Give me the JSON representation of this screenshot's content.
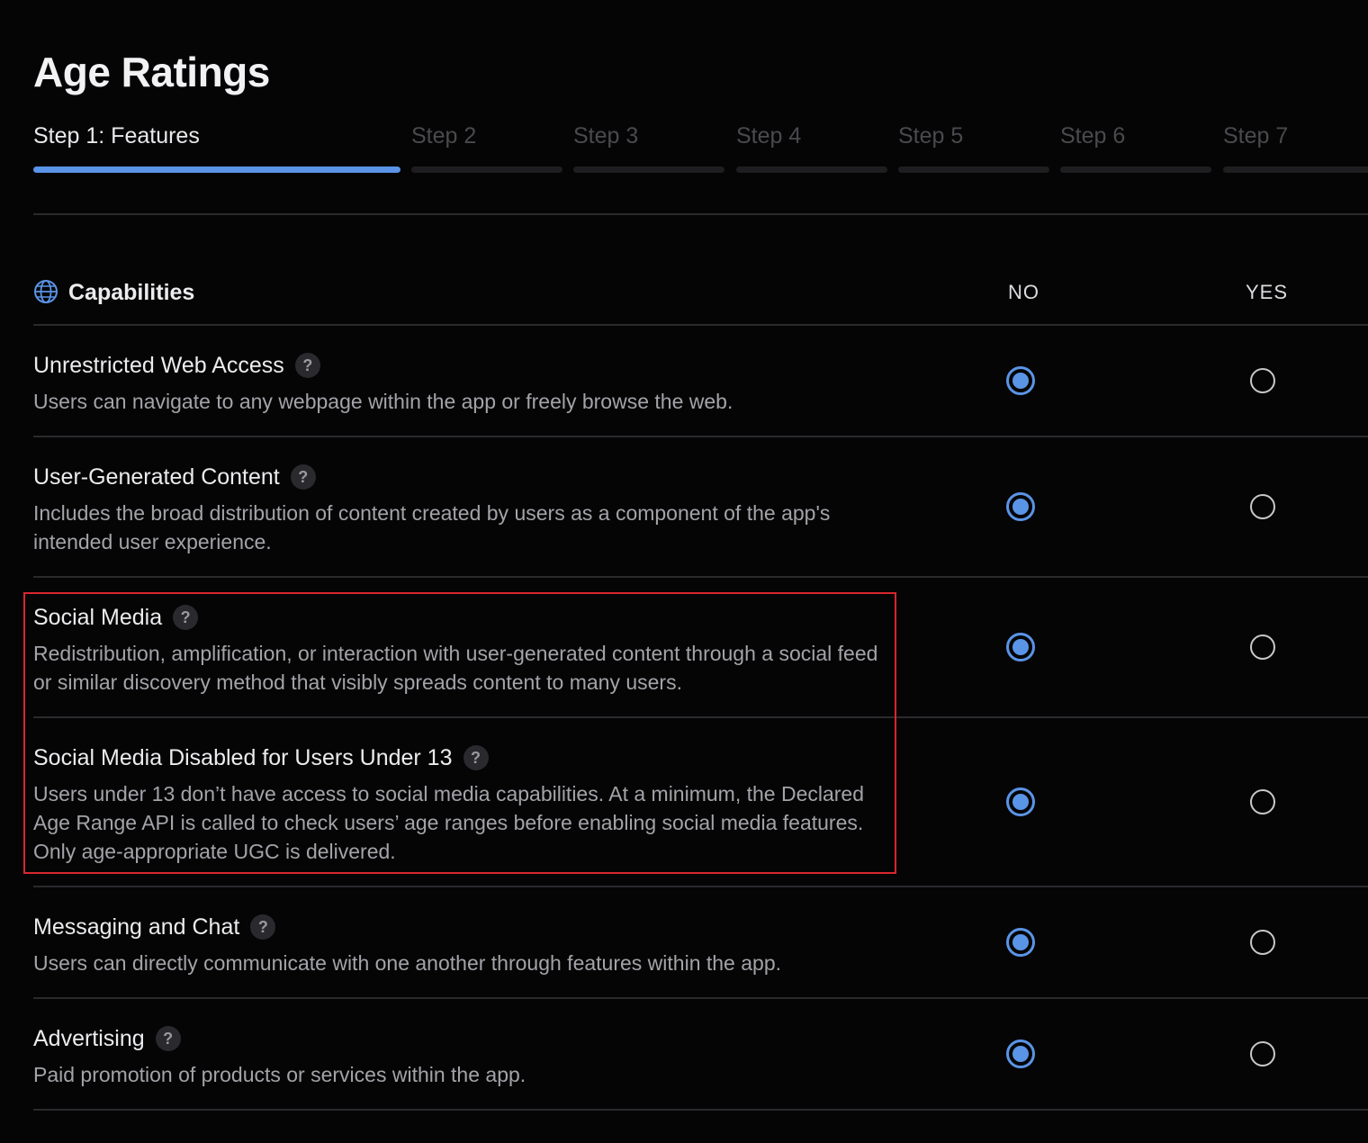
{
  "page": {
    "title": "Age Ratings"
  },
  "steps": [
    {
      "label": "Step 1: Features",
      "active": true
    },
    {
      "label": "Step 2",
      "active": false
    },
    {
      "label": "Step 3",
      "active": false
    },
    {
      "label": "Step 4",
      "active": false
    },
    {
      "label": "Step 5",
      "active": false
    },
    {
      "label": "Step 6",
      "active": false
    },
    {
      "label": "Step 7",
      "active": false
    }
  ],
  "section": {
    "title": "Capabilities",
    "icon": "globe-icon",
    "col_no": "NO",
    "col_yes": "YES"
  },
  "rows": [
    {
      "title": "Unrestricted Web Access",
      "description": "Users can navigate to any webpage within the app or freely browse the web.",
      "selected": "no"
    },
    {
      "title": "User-Generated Content",
      "description": "Includes the broad distribution of content created by users as a component of the app's intended user experience.",
      "selected": "no"
    },
    {
      "title": "Social Media",
      "description": "Redistribution, amplification, or interaction with user-generated content through a social feed or similar discovery method that visibly spreads content to many users.",
      "selected": "no"
    },
    {
      "title": "Social Media Disabled for Users Under 13",
      "description": "Users under 13 don’t have access to social media capabilities. At a minimum, the Declared Age Range API is called to check users’ age ranges before enabling social media features. Only age-appropriate UGC is delivered.",
      "selected": "no"
    },
    {
      "title": "Messaging and Chat",
      "description": "Users can directly communicate with one another through features within the app.",
      "selected": "no"
    },
    {
      "title": "Advertising",
      "description": "Paid promotion of products or services within the app.",
      "selected": "no"
    }
  ],
  "help_glyph": "?",
  "colors": {
    "accent": "#5a94e6",
    "highlight": "#d8262e",
    "background": "#050506"
  }
}
